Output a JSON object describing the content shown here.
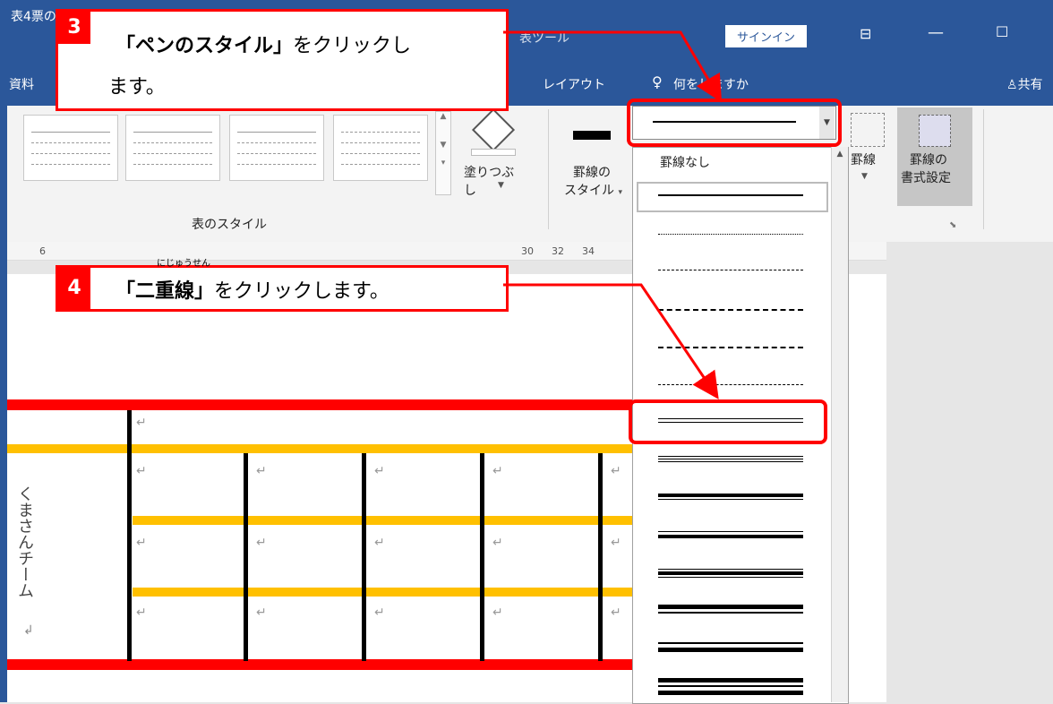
{
  "window": {
    "title": "表4票の",
    "context_tools": "表ツール",
    "signin": "サインイン"
  },
  "tabs": {
    "left": "資料",
    "layout": "レイアウト",
    "tell_me": "何をしますか",
    "share": "共有"
  },
  "ribbon": {
    "table_styles_group": "表のスタイル",
    "shading_label": "塗りつぶし",
    "pen_style_label_1": "罫線の",
    "pen_style_label_2": "スタイル",
    "borders_label": "罫線",
    "border_painter_1": "罫線の",
    "border_painter_2": "書式設定"
  },
  "ruler": [
    "6",
    "30",
    "32",
    "34"
  ],
  "callout3": {
    "number": "3",
    "bold": "「ペンのスタイル」",
    "rest": "をクリックし",
    "line2": "ます。"
  },
  "callout4": {
    "number": "4",
    "ruby": "にじゅうせん",
    "bold": "「二重線」",
    "rest": "をクリックします。"
  },
  "dropdown": {
    "no_border": "罫線なし"
  },
  "table": {
    "row_header": "くまさんチーム",
    "return_mark": "↵",
    "newline_mark": "↲"
  },
  "colors": {
    "accent": "#2b579a",
    "highlight": "#ff0000",
    "border_yellow": "#ffc000"
  }
}
